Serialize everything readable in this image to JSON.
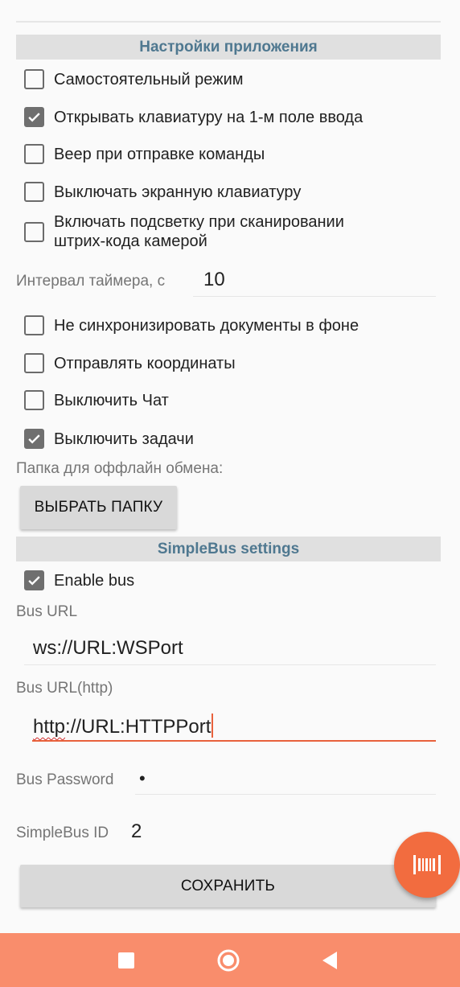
{
  "app_settings": {
    "header": "Настройки приложения",
    "checkboxes": [
      {
        "label": "Самостоятельный режим",
        "checked": false
      },
      {
        "label": "Открывать клавиатуру на 1-м поле ввода",
        "checked": true
      },
      {
        "label": "Веер при отправке команды",
        "checked": false
      },
      {
        "label": "Выключать экранную клавиатуру",
        "checked": false
      },
      {
        "label_line1": "Включать подсветку при сканировании",
        "label_line2": "штрих-кода камерой",
        "checked": false
      }
    ],
    "timer_label": "Интервал таймера, с",
    "timer_value": "10",
    "checkboxes2": [
      {
        "label": "Не синхронизировать документы в фоне",
        "checked": false
      },
      {
        "label": "Отправлять координаты",
        "checked": false
      },
      {
        "label": "Выключить Чат",
        "checked": false
      },
      {
        "label": "Выключить задачи",
        "checked": true
      }
    ],
    "folder_label": "Папка для оффлайн обмена:",
    "folder_button": "ВЫБРАТЬ ПАПКУ"
  },
  "simplebus": {
    "header": "SimpleBus settings",
    "enable_bus": {
      "label": "Enable bus",
      "checked": true
    },
    "bus_url_label": "Bus URL",
    "bus_url_value": "ws://URL:WSPort",
    "bus_url_http_label": "Bus URL(http)",
    "bus_url_http_value_misspelled": "http",
    "bus_url_http_value_rest": "://URL:HTTPPort",
    "password_label": "Bus Password",
    "password_value": "•",
    "id_label": "SimpleBus ID",
    "id_value": "2"
  },
  "save_button": "СОХРАНИТЬ",
  "colors": {
    "accent": "#f26c3f",
    "navbar": "#f98d6c",
    "header_text": "#4f7890",
    "header_bg": "#e0e0e0"
  },
  "icons": {
    "fab": "barcode-icon",
    "nav_recents": "square-icon",
    "nav_home": "circle-icon",
    "nav_back": "triangle-back-icon"
  }
}
